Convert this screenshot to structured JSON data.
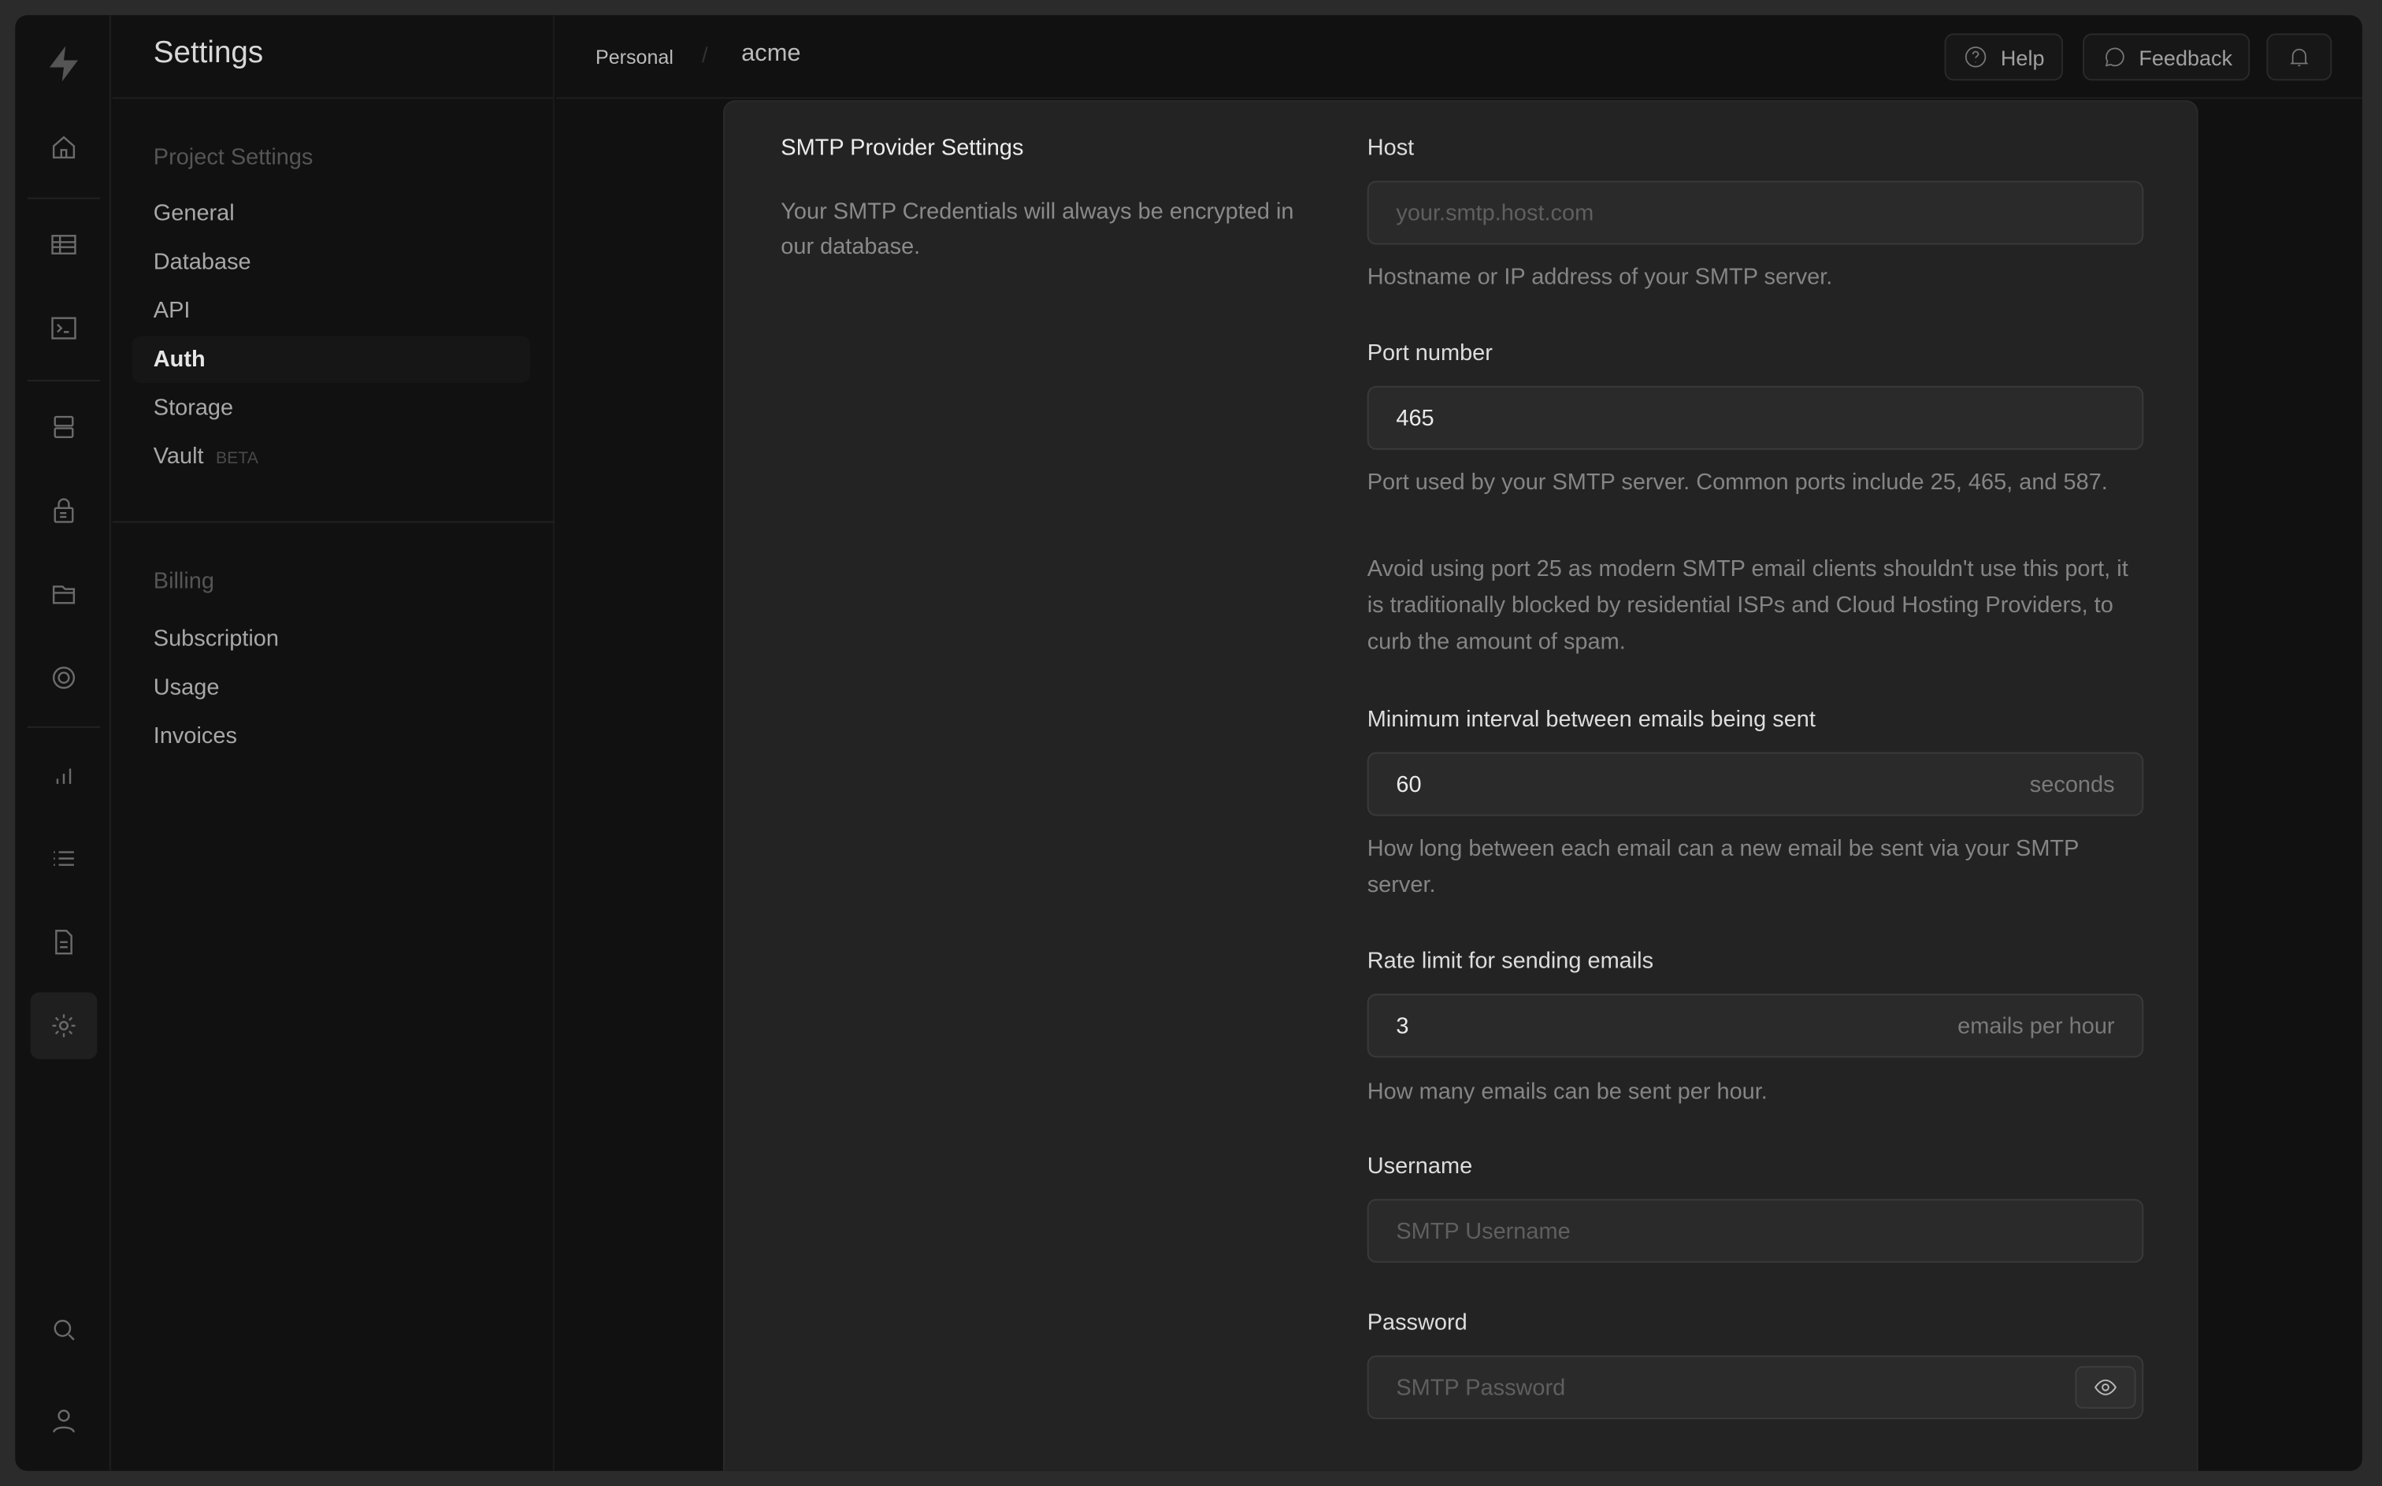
{
  "rail": {
    "icons": [
      "logo-icon",
      "home-icon",
      "table-editor-icon",
      "sql-editor-icon",
      "database-icon",
      "auth-icon",
      "storage-icon",
      "realtime-icon",
      "reports-icon",
      "logs-icon",
      "docs-icon",
      "settings-icon",
      "search-icon",
      "user-icon"
    ]
  },
  "sidebar": {
    "title": "Settings",
    "project_section": "Project Settings",
    "project_items": [
      {
        "label": "General"
      },
      {
        "label": "Database"
      },
      {
        "label": "API"
      },
      {
        "label": "Auth"
      },
      {
        "label": "Storage"
      },
      {
        "label": "Vault",
        "badge": "BETA"
      }
    ],
    "billing_section": "Billing",
    "billing_items": [
      {
        "label": "Subscription"
      },
      {
        "label": "Usage"
      },
      {
        "label": "Invoices"
      }
    ],
    "active": "Auth"
  },
  "topbar": {
    "breadcrumb": [
      "Personal",
      "acme"
    ],
    "separator": "/",
    "help": "Help",
    "feedback": "Feedback"
  },
  "panel": {
    "title": "SMTP Provider Settings",
    "description": "Your SMTP Credentials will always be encrypted in our database.",
    "fields": {
      "host": {
        "label": "Host",
        "placeholder": "your.smtp.host.com",
        "help": "Hostname or IP address of your SMTP server."
      },
      "port": {
        "label": "Port number",
        "value": "465",
        "help": "Port used by your SMTP server. Common ports include 25, 465, and 587.",
        "help2": "Avoid using port 25 as modern SMTP email clients shouldn't use this port, it is traditionally blocked by residential ISPs and Cloud Hosting Providers, to curb the amount of spam."
      },
      "interval": {
        "label": "Minimum interval between emails being sent",
        "value": "60",
        "suffix": "seconds",
        "help": "How long between each email can a new email be sent via your SMTP server."
      },
      "rate": {
        "label": "Rate limit for sending emails",
        "value": "3",
        "suffix": "emails per hour",
        "help": "How many emails can be sent per hour."
      },
      "username": {
        "label": "Username",
        "placeholder": "SMTP Username"
      },
      "password": {
        "label": "Password",
        "placeholder": "SMTP Password"
      }
    }
  }
}
